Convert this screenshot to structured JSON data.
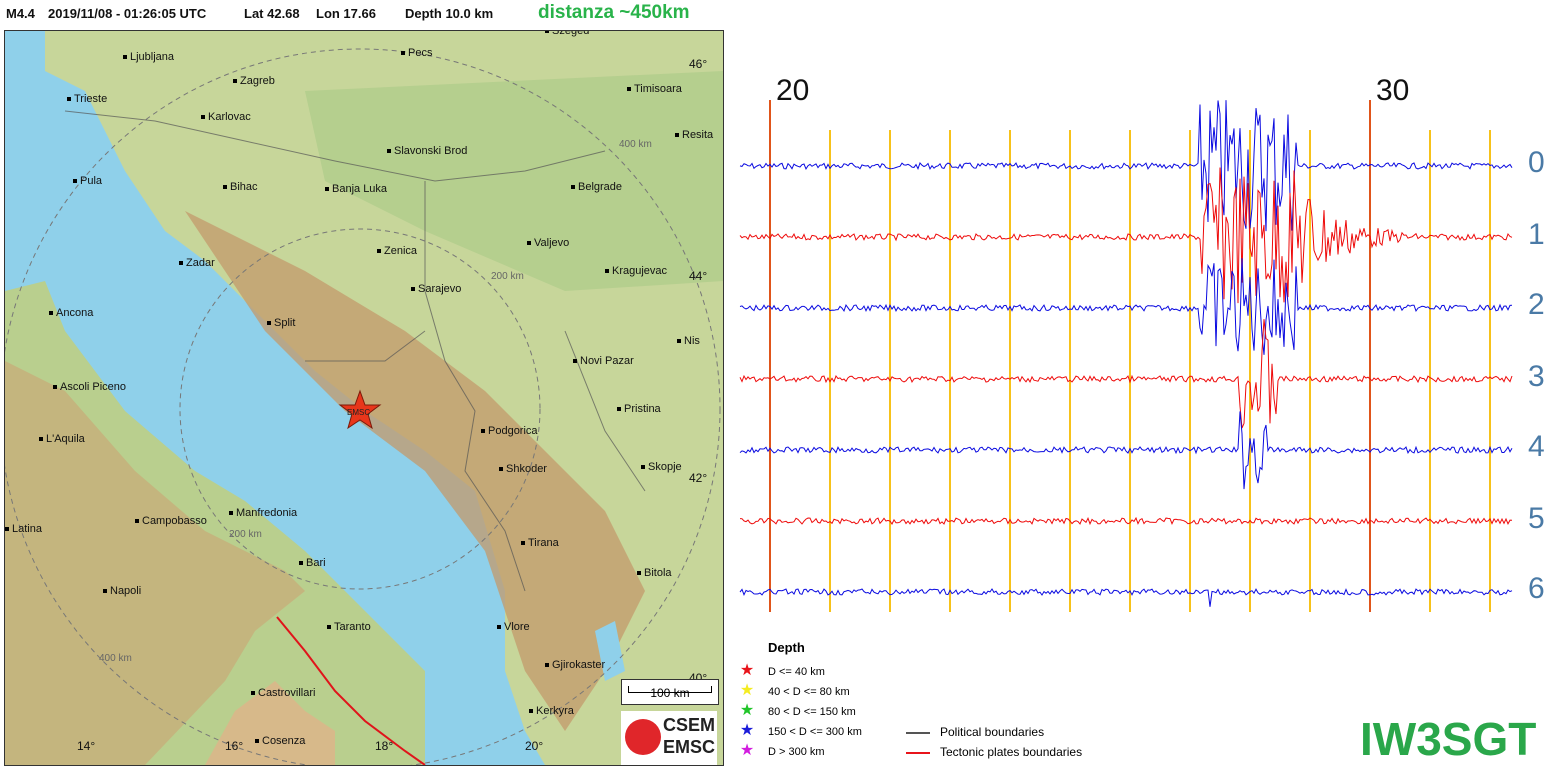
{
  "header": {
    "magnitude": "M4.4",
    "datetime": "2019/11/08 - 01:26:05 UTC",
    "lat": "Lat 42.68",
    "lon": "Lon 17.66",
    "depth": "Depth  10.0 km",
    "distance": "distanza ~450km"
  },
  "map": {
    "cities": [
      {
        "name": "Ljubljana"
      },
      {
        "name": "Pecs"
      },
      {
        "name": "Szeged"
      },
      {
        "name": "Zagreb"
      },
      {
        "name": "Timisoara"
      },
      {
        "name": "Trieste"
      },
      {
        "name": "Karlovac"
      },
      {
        "name": "Resita"
      },
      {
        "name": "Slavonski Brod"
      },
      {
        "name": "Pula"
      },
      {
        "name": "Bihac"
      },
      {
        "name": "Banja Luka"
      },
      {
        "name": "Belgrade"
      },
      {
        "name": "Zenica"
      },
      {
        "name": "Valjevo"
      },
      {
        "name": "Zadar"
      },
      {
        "name": "Kragujevac"
      },
      {
        "name": "Sarajevo"
      },
      {
        "name": "Ancona"
      },
      {
        "name": "Split"
      },
      {
        "name": "Nis"
      },
      {
        "name": "Novi Pazar"
      },
      {
        "name": "Ascoli Piceno"
      },
      {
        "name": "Pristina"
      },
      {
        "name": "L'Aquila"
      },
      {
        "name": "Podgorica"
      },
      {
        "name": "Shkoder"
      },
      {
        "name": "Skopje"
      },
      {
        "name": "Latina"
      },
      {
        "name": "Manfredonia"
      },
      {
        "name": "Campobasso"
      },
      {
        "name": "Tirana"
      },
      {
        "name": "Bari"
      },
      {
        "name": "Bitola"
      },
      {
        "name": "Napoli"
      },
      {
        "name": "Taranto"
      },
      {
        "name": "Vlore"
      },
      {
        "name": "Gjirokaster"
      },
      {
        "name": "Castrovillari"
      },
      {
        "name": "Kerkyra"
      },
      {
        "name": "Cosenza"
      }
    ],
    "lat_labels": [
      "46°",
      "44°",
      "42°",
      "40°"
    ],
    "lon_labels": [
      "14°",
      "16°",
      "18°",
      "20°"
    ],
    "ring_labels": [
      "400 km",
      "200 km",
      "200 km",
      "400 km"
    ],
    "epicenter_label": "EMSC",
    "scale": "100 km",
    "logo_top": "CSEM",
    "logo_bottom": "EMSC"
  },
  "legend": {
    "title": "Depth",
    "items": [
      {
        "label": "D <= 40 km",
        "color": "#e8141b"
      },
      {
        "label": "40 < D <= 80 km",
        "color": "#f4ec22"
      },
      {
        "label": "80 < D <= 150 km",
        "color": "#22c52a"
      },
      {
        "label": "150 < D <= 300 km",
        "color": "#1c1cd9"
      },
      {
        "label": "D > 300 km",
        "color": "#d21ddf"
      }
    ],
    "boundaries": [
      {
        "label": "Political boundaries",
        "color": "#555555"
      },
      {
        "label": "Tectonic plates boundaries",
        "color": "#e8141b"
      }
    ]
  },
  "seismogram": {
    "minute_labels": [
      "20",
      "30"
    ],
    "channels": [
      "0",
      "1",
      "2",
      "3",
      "4",
      "5",
      "6"
    ],
    "trace_colors": [
      "#0a0ae0",
      "#ee0a0a"
    ],
    "gridline_color": "#f7c21a",
    "major_line_color": "#e0551a"
  },
  "callsign": "IW3SGT"
}
